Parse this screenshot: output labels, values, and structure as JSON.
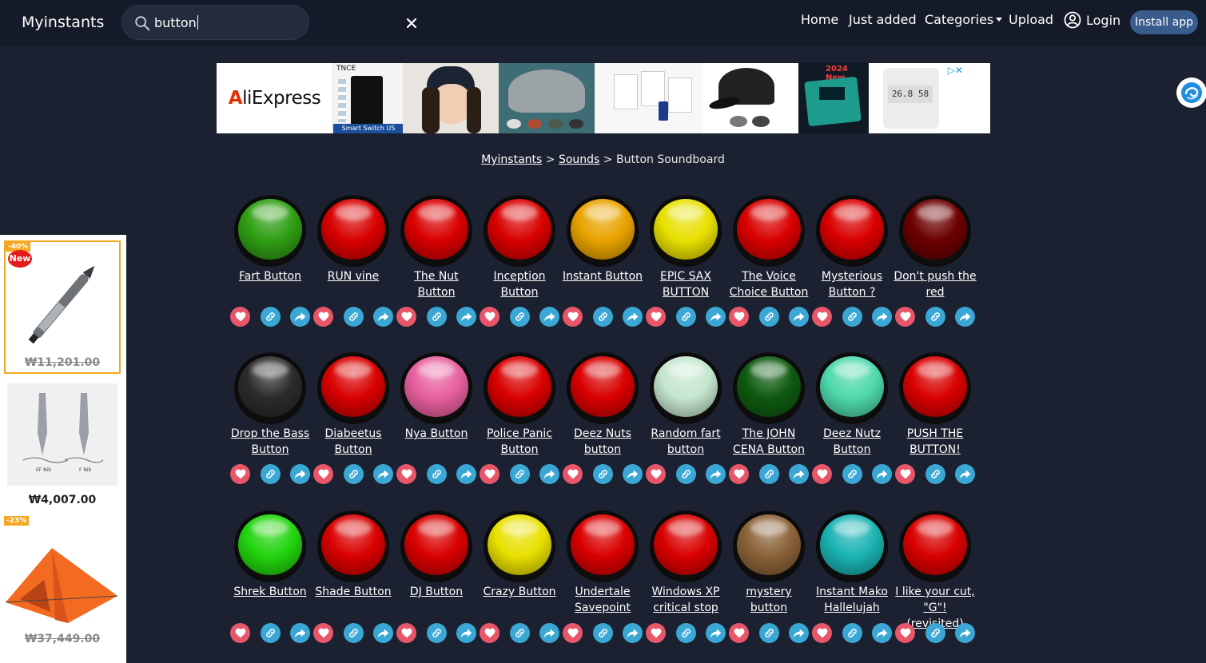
{
  "navbar": {
    "brand": "Myinstants",
    "search_value": "button",
    "links": {
      "home": "Home",
      "just_added": "Just added",
      "categories": "Categories",
      "upload": "Upload",
      "login": "Login"
    },
    "install_app": "Install app"
  },
  "ad_banner": {
    "logo_prefix": "A",
    "logo_rest": "liExpress",
    "tile_text_1": "TNCE",
    "tile_text_1b": "Smart Switch US",
    "tile_text_2": "2024 New"
  },
  "breadcrumb": {
    "home": "Myinstants",
    "sounds": "Sounds",
    "separator": ">",
    "current": "Button Soundboard"
  },
  "left_ad": {
    "items": [
      {
        "discount": "-40%",
        "badge": "New",
        "price": "₩11,201.00",
        "strike": true
      },
      {
        "price": "₩4,007.00",
        "strike": false
      },
      {
        "discount": "-23%",
        "price": "₩37,449.00",
        "strike": true
      }
    ]
  },
  "colors": {
    "red": "#d90000",
    "green": "#2f9e14",
    "yellow_orange": "#e9a300",
    "yellow": "#e8e000",
    "dark_red": "#6b0000",
    "black": "#2b2b2b",
    "pink": "#e8609e",
    "light_green": "#c5e6cf",
    "dark_green": "#0e5a10",
    "aqua": "#4fd9ad",
    "lime": "#22d40e",
    "brown": "#8a6238",
    "teal": "#1bb3b3",
    "favorite": "#e8566a",
    "link": "#3aa7d4"
  },
  "sounds": [
    {
      "title": "Fart Button",
      "color": "green"
    },
    {
      "title": "RUN vine",
      "color": "red"
    },
    {
      "title": "The Nut Button",
      "color": "red"
    },
    {
      "title": "Inception Button",
      "color": "red"
    },
    {
      "title": "Instant Button",
      "color": "yellow_orange"
    },
    {
      "title": "EPIC SAX BUTTON",
      "color": "yellow"
    },
    {
      "title": "The Voice Choice Button",
      "color": "red"
    },
    {
      "title": "Mysterious Button ?",
      "color": "red"
    },
    {
      "title": "Don't push the red",
      "color": "dark_red"
    },
    {
      "title": "Drop the Bass Button",
      "color": "black"
    },
    {
      "title": "Diabeetus Button",
      "color": "red"
    },
    {
      "title": "Nya Button",
      "color": "pink"
    },
    {
      "title": "Police Panic Button",
      "color": "red"
    },
    {
      "title": "Deez Nuts button",
      "color": "red"
    },
    {
      "title": "Random fart button",
      "color": "light_green"
    },
    {
      "title": "The JOHN CENA Button",
      "color": "dark_green"
    },
    {
      "title": "Deez Nutz Button",
      "color": "aqua"
    },
    {
      "title": "PUSH THE BUTTON!",
      "color": "red"
    },
    {
      "title": "Shrek Button",
      "color": "lime"
    },
    {
      "title": "Shade Button",
      "color": "red"
    },
    {
      "title": "DJ Button",
      "color": "red"
    },
    {
      "title": "Crazy Button",
      "color": "yellow"
    },
    {
      "title": "Undertale Savepoint",
      "color": "red"
    },
    {
      "title": "Windows XP critical stop",
      "color": "red"
    },
    {
      "title": "mystery button",
      "color": "brown"
    },
    {
      "title": "Instant Mako Hallelujah",
      "color": "teal"
    },
    {
      "title": "I like your cut, \"G\"! (revisited)",
      "color": "red"
    }
  ]
}
